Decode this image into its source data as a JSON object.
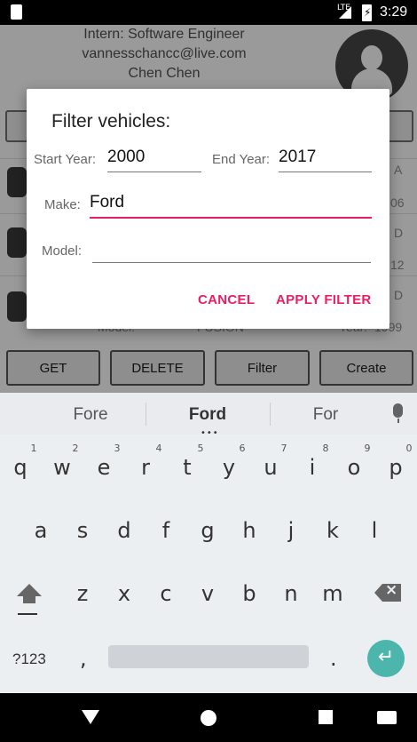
{
  "status_bar": {
    "network": "LTE",
    "battery_symbol": "⚡",
    "time": "3:29"
  },
  "profile": {
    "title_line": "Intern: Software Engineer",
    "email": "vannesschancc@live.com",
    "name": "Chen Chen",
    "phone_partial": "___ ___ ____"
  },
  "background": {
    "row_right_texts": [
      "A",
      "06",
      "D",
      "12",
      "D"
    ],
    "row4_label": "Model:",
    "row4_value": "FUSION",
    "row4_year_label": "Year:",
    "row4_year_value": "1999"
  },
  "action_buttons": {
    "get": "GET",
    "delete": "DELETE",
    "filter": "Filter",
    "create": "Create"
  },
  "dialog": {
    "title": "Filter vehicles:",
    "start_year_label": "Start Year:",
    "start_year_value": "2000",
    "end_year_label": "End Year:",
    "end_year_value": "2017",
    "make_label": "Make:",
    "make_value": "Ford",
    "model_label": "Model:",
    "model_value": "",
    "cancel_label": "CANCEL",
    "apply_label": "APPLY FILTER",
    "accent_color": "#e91e63"
  },
  "keyboard": {
    "suggestions": [
      "Fore",
      "Ford",
      "For"
    ],
    "row1": [
      "q",
      "w",
      "e",
      "r",
      "t",
      "y",
      "u",
      "i",
      "o",
      "p"
    ],
    "row1_numbers": [
      "1",
      "2",
      "3",
      "4",
      "5",
      "6",
      "7",
      "8",
      "9",
      "0"
    ],
    "row2": [
      "a",
      "s",
      "d",
      "f",
      "g",
      "h",
      "j",
      "k",
      "l"
    ],
    "row3": [
      "z",
      "x",
      "c",
      "v",
      "b",
      "n",
      "m"
    ],
    "symbols_key": "?123",
    "comma_key": ",",
    "period_key": ".",
    "enter_icon": "enter-arrow-icon",
    "enter_color": "#4db6ac"
  },
  "nav_bar": {
    "back": "back-icon",
    "home": "home-icon",
    "recents": "recents-icon",
    "keyboard": "keyboard-switch-icon"
  }
}
